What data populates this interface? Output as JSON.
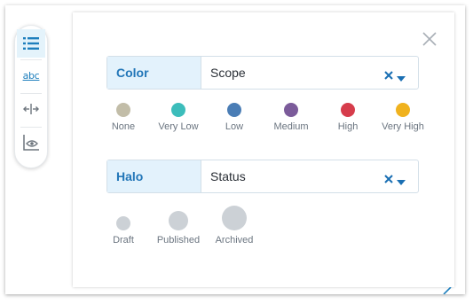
{
  "toolbar": {
    "buttons": [
      {
        "name": "list-view",
        "icon": "bulleted-list-icon",
        "active": true
      },
      {
        "name": "labels",
        "icon": "abc-text-icon",
        "text": "abc",
        "active": false
      },
      {
        "name": "spacing",
        "icon": "horizontal-spacing-icon",
        "active": false
      },
      {
        "name": "display",
        "icon": "chart-eye-icon",
        "active": false
      }
    ]
  },
  "panel": {
    "close_icon": "close-icon",
    "color": {
      "label": "Color",
      "value": "Scope",
      "legend": [
        {
          "label": "None",
          "color": "#c2bda8"
        },
        {
          "label": "Very Low",
          "color": "#3cbdbb"
        },
        {
          "label": "Low",
          "color": "#4a7db5"
        },
        {
          "label": "Medium",
          "color": "#7b5b9a"
        },
        {
          "label": "High",
          "color": "#d63c4b"
        },
        {
          "label": "Very High",
          "color": "#f0b21e"
        }
      ]
    },
    "halo": {
      "label": "Halo",
      "value": "Status",
      "legend": [
        {
          "label": "Draft",
          "size": "small"
        },
        {
          "label": "Published",
          "size": "medium"
        },
        {
          "label": "Archived",
          "size": "large"
        }
      ],
      "dot_color": "#ccd1d6"
    }
  },
  "colors": {
    "accent": "#2276b8",
    "field_label_bg": "#e3f2fc",
    "clear_icon": "#1a6fb3"
  }
}
